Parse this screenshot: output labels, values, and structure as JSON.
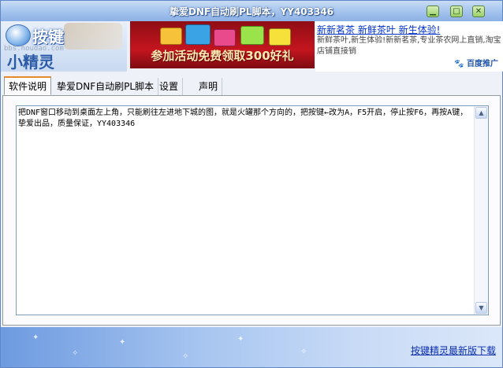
{
  "window": {
    "title": "挚爱DNF自动刷PL脚本，YY403346",
    "minimize_icon": "minimize-icon",
    "maximize_icon": "maximize-icon",
    "close_icon": "close-icon"
  },
  "logo": {
    "brand": "按键",
    "brand2": "小精灵",
    "url": "bbs.houdao.com"
  },
  "banner": {
    "text": "参加活动免费领取300好礼"
  },
  "ad": {
    "title": "新新茗茶 新鲜茶叶 新生体验!",
    "description": "新鲜茶叶,新生体验!新新茗茶,专业茶农网上直销,淘宝店铺直接销",
    "brand": "百度推广"
  },
  "tabs": [
    {
      "label": "软件说明"
    },
    {
      "label": "挚爱DNF自动刷PL脚本"
    },
    {
      "label": "设置"
    },
    {
      "label": "声明"
    }
  ],
  "content": {
    "text": "把DNF窗口移动到桌面左上角，只能刷往左进地下城的图，就是火罐那个方向的，把按键←改为A，F5开启，停止按F6，再按A键，    挚爱出品，质量保证，YY403346"
  },
  "status": {
    "link": "按键精灵最新版下载"
  },
  "colors": {
    "title_bar": "#a9c7ef",
    "tab_accent": "#e68b2c",
    "link": "#0b2fae",
    "banner_red": "#c4151f"
  }
}
